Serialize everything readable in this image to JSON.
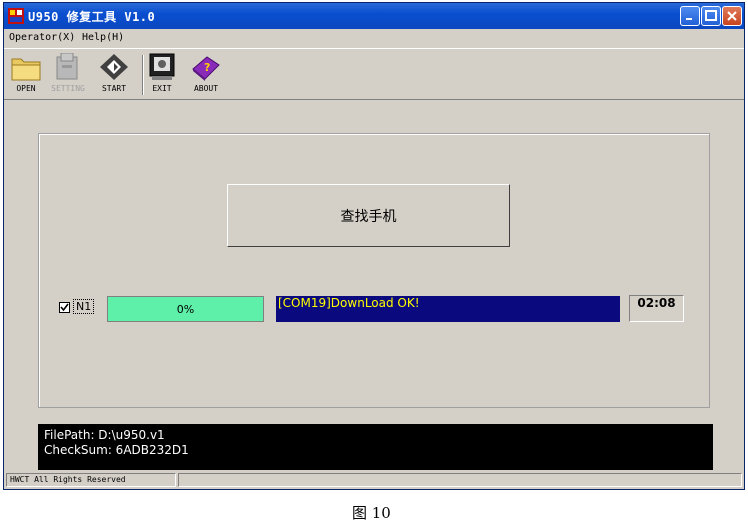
{
  "window": {
    "title": "U950 修复工具  V1.0"
  },
  "menu": [
    {
      "label": "Operator(X)"
    },
    {
      "label": "Help(H)"
    }
  ],
  "toolbar": {
    "items": [
      {
        "label": "OPEN",
        "icon": "folder-icon"
      },
      {
        "label": "SETTING",
        "icon": "settings-icon",
        "disabled": true
      },
      {
        "label": "START",
        "icon": "start-icon"
      },
      {
        "label": "EXIT",
        "icon": "exit-icon"
      },
      {
        "label": "ABOUT",
        "icon": "about-icon"
      }
    ]
  },
  "main": {
    "search_button": "查找手机",
    "port": {
      "label": "N1",
      "checked": true
    },
    "progress_text": "0%",
    "status_message": "[COM19]DownLoad OK!",
    "timer": "02:08"
  },
  "info": {
    "file_path": "FilePath: D:\\u950.v1",
    "checksum": "CheckSum: 6ADB232D1"
  },
  "statusbar": {
    "copyright": "HWCT All Rights Reserved",
    "secondary": ""
  },
  "caption": "图  10",
  "colors": {
    "progress": "#5ef0a8",
    "status_bg": "#0a0a7e",
    "status_text": "#ffff00"
  }
}
